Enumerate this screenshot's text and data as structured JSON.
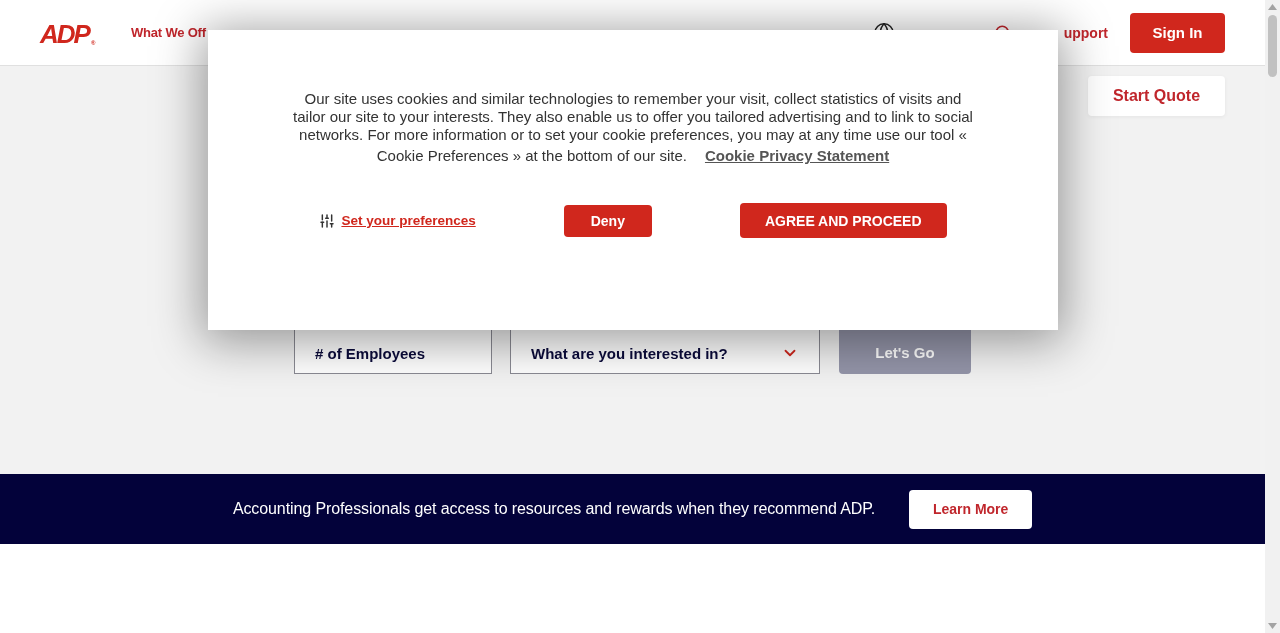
{
  "header": {
    "logo": {
      "text": "ADP",
      "mark": "®"
    },
    "nav": [
      {
        "label": "What We Off"
      }
    ],
    "support_link": "upport",
    "sign_in": "Sign In"
  },
  "hero": {
    "start_quote": "Start Quote",
    "form": {
      "employees_field": {
        "placeholder": "# of Employees"
      },
      "interest_select": {
        "placeholder": "What are you interested in?"
      },
      "submit": {
        "label": "Let's Go",
        "disabled": true
      }
    }
  },
  "banner": {
    "message": "Accounting Professionals get access to resources and rewards when they recommend ADP.",
    "button": "Learn More"
  },
  "cookie_dialog": {
    "message": "Our site uses cookies and similar technologies to remember your visit, collect statistics of visits and tailor our site to your interests. They also enable us to offer you tailored advertising and to link to social networks. For more information or to set your cookie preferences, you may at any time use our tool « Cookie Preferences » at the bottom of our site.",
    "privacy_link": "Cookie Privacy Statement",
    "preferences_link": "Set your preferences",
    "deny_button": "Deny",
    "agree_button": "AGREE AND PROCEED"
  }
}
